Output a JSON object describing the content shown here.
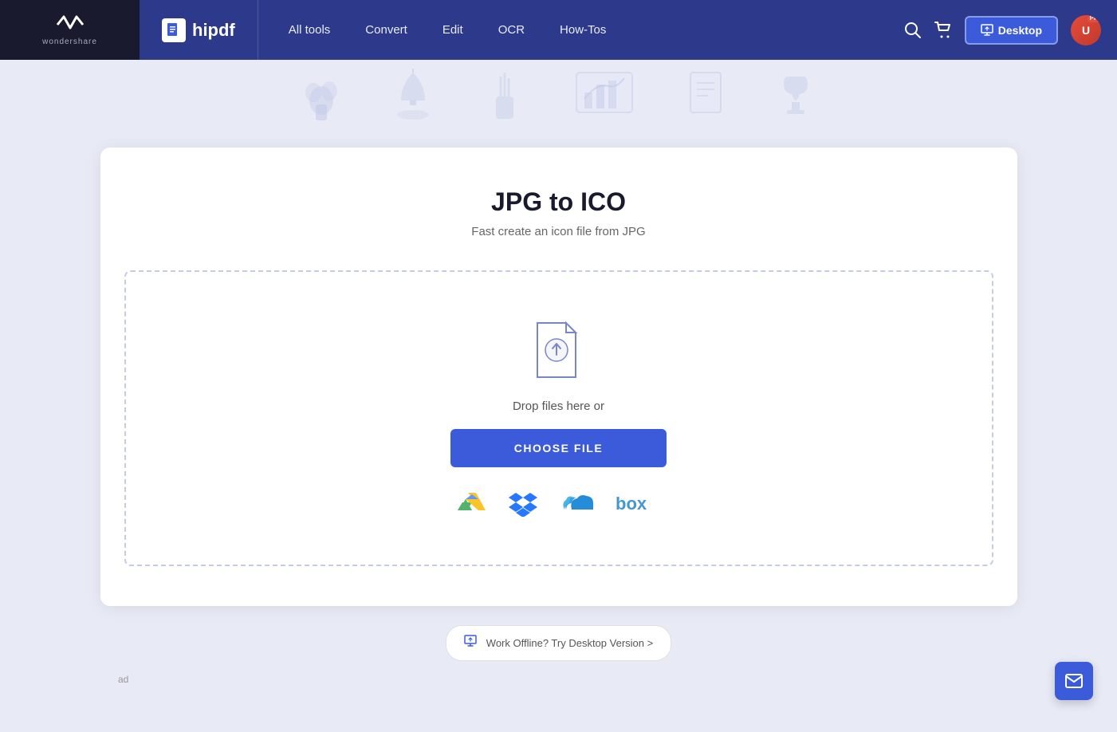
{
  "brand": {
    "wondershare_text": "wondershare",
    "ws_icon": "≋",
    "hipdf_text": "hipdf"
  },
  "navbar": {
    "links": [
      {
        "label": "All tools",
        "key": "all-tools"
      },
      {
        "label": "Convert",
        "key": "convert"
      },
      {
        "label": "Edit",
        "key": "edit"
      },
      {
        "label": "OCR",
        "key": "ocr"
      },
      {
        "label": "How-Tos",
        "key": "how-tos"
      }
    ],
    "desktop_btn": "Desktop",
    "pro_label": "Pro"
  },
  "page": {
    "title": "JPG to ICO",
    "subtitle": "Fast create an icon file from JPG",
    "drop_text": "Drop files here or",
    "choose_file_btn": "CHOOSE FILE",
    "offline_text": "Work Offline? Try Desktop Version >"
  },
  "cloud_services": [
    {
      "name": "Google Drive",
      "key": "gdrive"
    },
    {
      "name": "Dropbox",
      "key": "dropbox"
    },
    {
      "name": "OneDrive",
      "key": "onedrive"
    },
    {
      "name": "Box",
      "key": "box"
    }
  ],
  "ad_text": "ad"
}
